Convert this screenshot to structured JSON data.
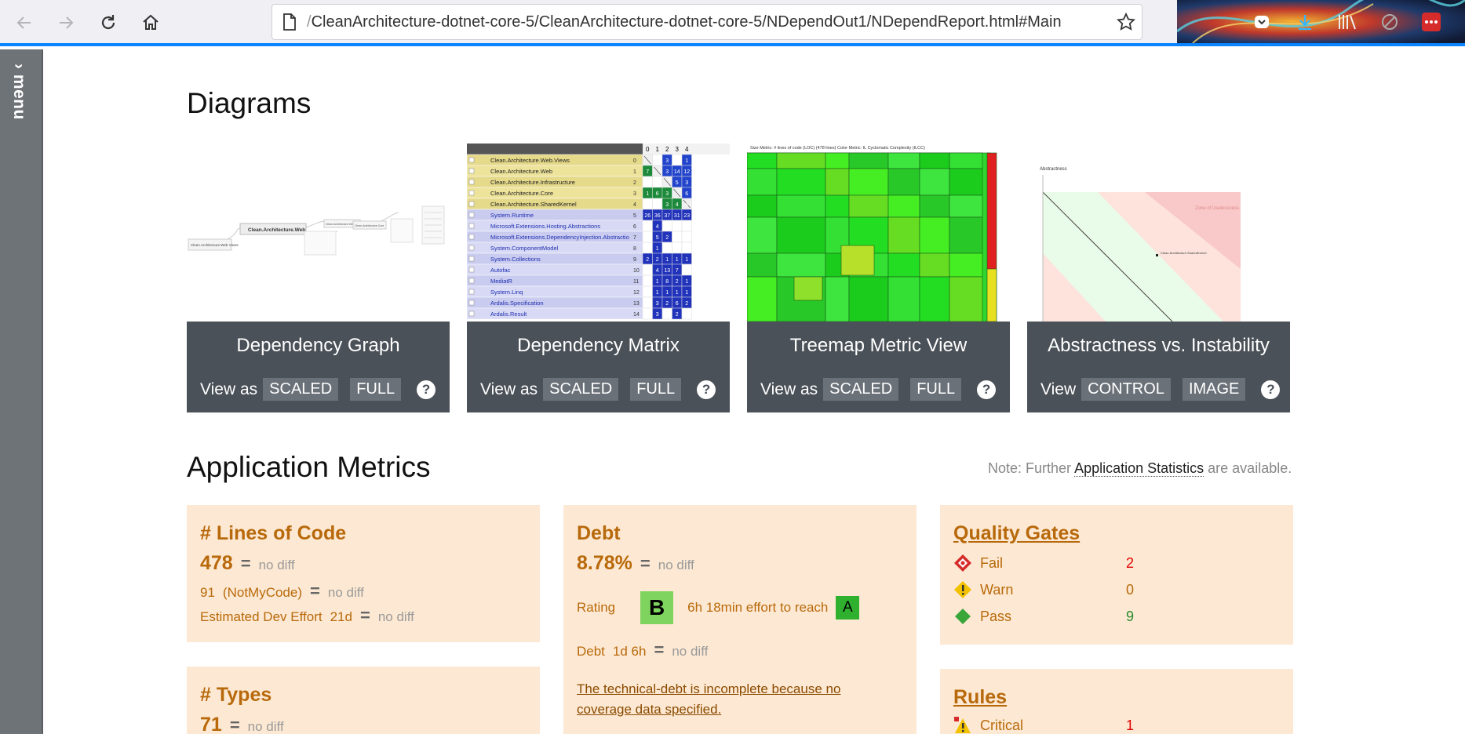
{
  "browser": {
    "url_prefix": "/",
    "url": "CleanArchitecture-dotnet-core-5/CleanArchitecture-dotnet-core-5/NDependOut1/NDependReport.html#Main"
  },
  "sidebar": {
    "menu_label": "menu"
  },
  "diagrams": {
    "heading": "Diagrams",
    "items": [
      {
        "title": "Dependency Graph",
        "view_label": "View as",
        "btn1": "SCALED",
        "btn2": "FULL",
        "help": "?"
      },
      {
        "title": "Dependency Matrix",
        "view_label": "View as",
        "btn1": "SCALED",
        "btn2": "FULL",
        "help": "?"
      },
      {
        "title": "Treemap Metric View",
        "view_label": "View as",
        "btn1": "SCALED",
        "btn2": "FULL",
        "help": "?"
      },
      {
        "title": "Abstractness vs. Instability",
        "view_label": "View",
        "btn1": "CONTROL",
        "btn2": "IMAGE",
        "help": "?"
      }
    ],
    "graph_thumb": {
      "main": "Clean.Architecture.Web",
      "left": "Clean.Architecture.Web Views",
      "core": "Clean.Architecture.Core",
      "infra": "Clean.Architecture.Infrastructure"
    },
    "matrix_thumb": {
      "col_headers": [
        "0",
        "1",
        "2",
        "3",
        "4"
      ],
      "rows": [
        {
          "name": "Clean.Architecture.Web.Views",
          "idx": "0"
        },
        {
          "name": "Clean.Architecture.Web",
          "idx": "1"
        },
        {
          "name": "Clean.Architecture.Infrastructure",
          "idx": "2"
        },
        {
          "name": "Clean.Architecture.Core",
          "idx": "3"
        },
        {
          "name": "Clean.Architecture.SharedKernel",
          "idx": "4"
        },
        {
          "name": "System.Runtime",
          "idx": "5"
        },
        {
          "name": "Microsoft.Extensions.Hosting.Abstractions",
          "idx": "6"
        },
        {
          "name": "Microsoft.Extensions.DependencyInjection.Abstractio",
          "idx": "7"
        },
        {
          "name": "System.ComponentModel",
          "idx": "8"
        },
        {
          "name": "System.Collections",
          "idx": "9"
        },
        {
          "name": "Autofac",
          "idx": "10"
        },
        {
          "name": "MediatR",
          "idx": "11"
        },
        {
          "name": "System.Linq",
          "idx": "12"
        },
        {
          "name": "Ardalis.Specification",
          "idx": "13"
        },
        {
          "name": "Ardalis.Result",
          "idx": "14"
        }
      ],
      "cells": [
        [
          "",
          "",
          "3",
          "",
          "1"
        ],
        [
          "7",
          "",
          "3",
          "14",
          "12"
        ],
        [
          "",
          "",
          "",
          "5",
          "3"
        ],
        [
          "1",
          "6",
          "3",
          "",
          "6"
        ],
        [
          "",
          "",
          "3",
          "4",
          "4"
        ],
        [
          "26",
          "36",
          "37",
          "31",
          "23"
        ],
        [
          "",
          "4",
          "",
          "",
          ""
        ],
        [
          "",
          "5",
          "2",
          "",
          ""
        ],
        [
          "",
          "1",
          "",
          "",
          ""
        ],
        [
          "2",
          "2",
          "1",
          "1",
          "1"
        ],
        [
          "",
          "4",
          "13",
          "7",
          ""
        ],
        [
          "",
          "1",
          "8",
          "2",
          "1"
        ],
        [
          "",
          "1",
          "1",
          "1",
          "1"
        ],
        [
          "",
          "3",
          "2",
          "6",
          "2"
        ],
        [
          "",
          "3",
          "",
          "2",
          ""
        ]
      ]
    },
    "treemap_thumb": {
      "caption": "Size Metric: # lines of code (LOC) (478 lines)    Color Metric: IL Cyclomatic Complexity (ILCC)"
    },
    "ai_thumb": {
      "y_label": "Abstractness",
      "zone": "Zone of Uselessness",
      "point_label": "Clean.Architecture.SharedKernel"
    }
  },
  "metrics": {
    "heading": "Application Metrics",
    "note_prefix": "Note: Further",
    "note_link": "Application Statistics",
    "note_suffix": "are available.",
    "loc": {
      "title": "# Lines of Code",
      "value": "478",
      "diff": "no diff",
      "notmycode_value": "91",
      "notmycode_label": "(NotMyCode)",
      "notmycode_diff": "no diff",
      "effort_label": "Estimated Dev Effort",
      "effort_value": "21d",
      "effort_diff": "no diff"
    },
    "types": {
      "title": "# Types",
      "value": "71",
      "diff": "no diff"
    },
    "debt": {
      "title": "Debt",
      "value": "8.78%",
      "diff": "no diff",
      "rating_label": "Rating",
      "rating": "B",
      "effort_text": "6h 18min effort to reach",
      "target_rating": "A",
      "debt_label": "Debt",
      "debt_value": "1d 6h",
      "debt_diff": "no diff",
      "warning": "The technical-debt is incomplete because no coverage data specified."
    },
    "quality_gates": {
      "title": "Quality Gates",
      "rows": [
        {
          "name": "Fail",
          "count": "2",
          "color": "#e00000"
        },
        {
          "name": "Warn",
          "count": "0",
          "color": "#b8690b"
        },
        {
          "name": "Pass",
          "count": "9",
          "color": "#2a8a2a"
        }
      ]
    },
    "rules": {
      "title": "Rules",
      "rows": [
        {
          "name": "Critical",
          "count": "1"
        }
      ]
    }
  },
  "equals_sign": "="
}
